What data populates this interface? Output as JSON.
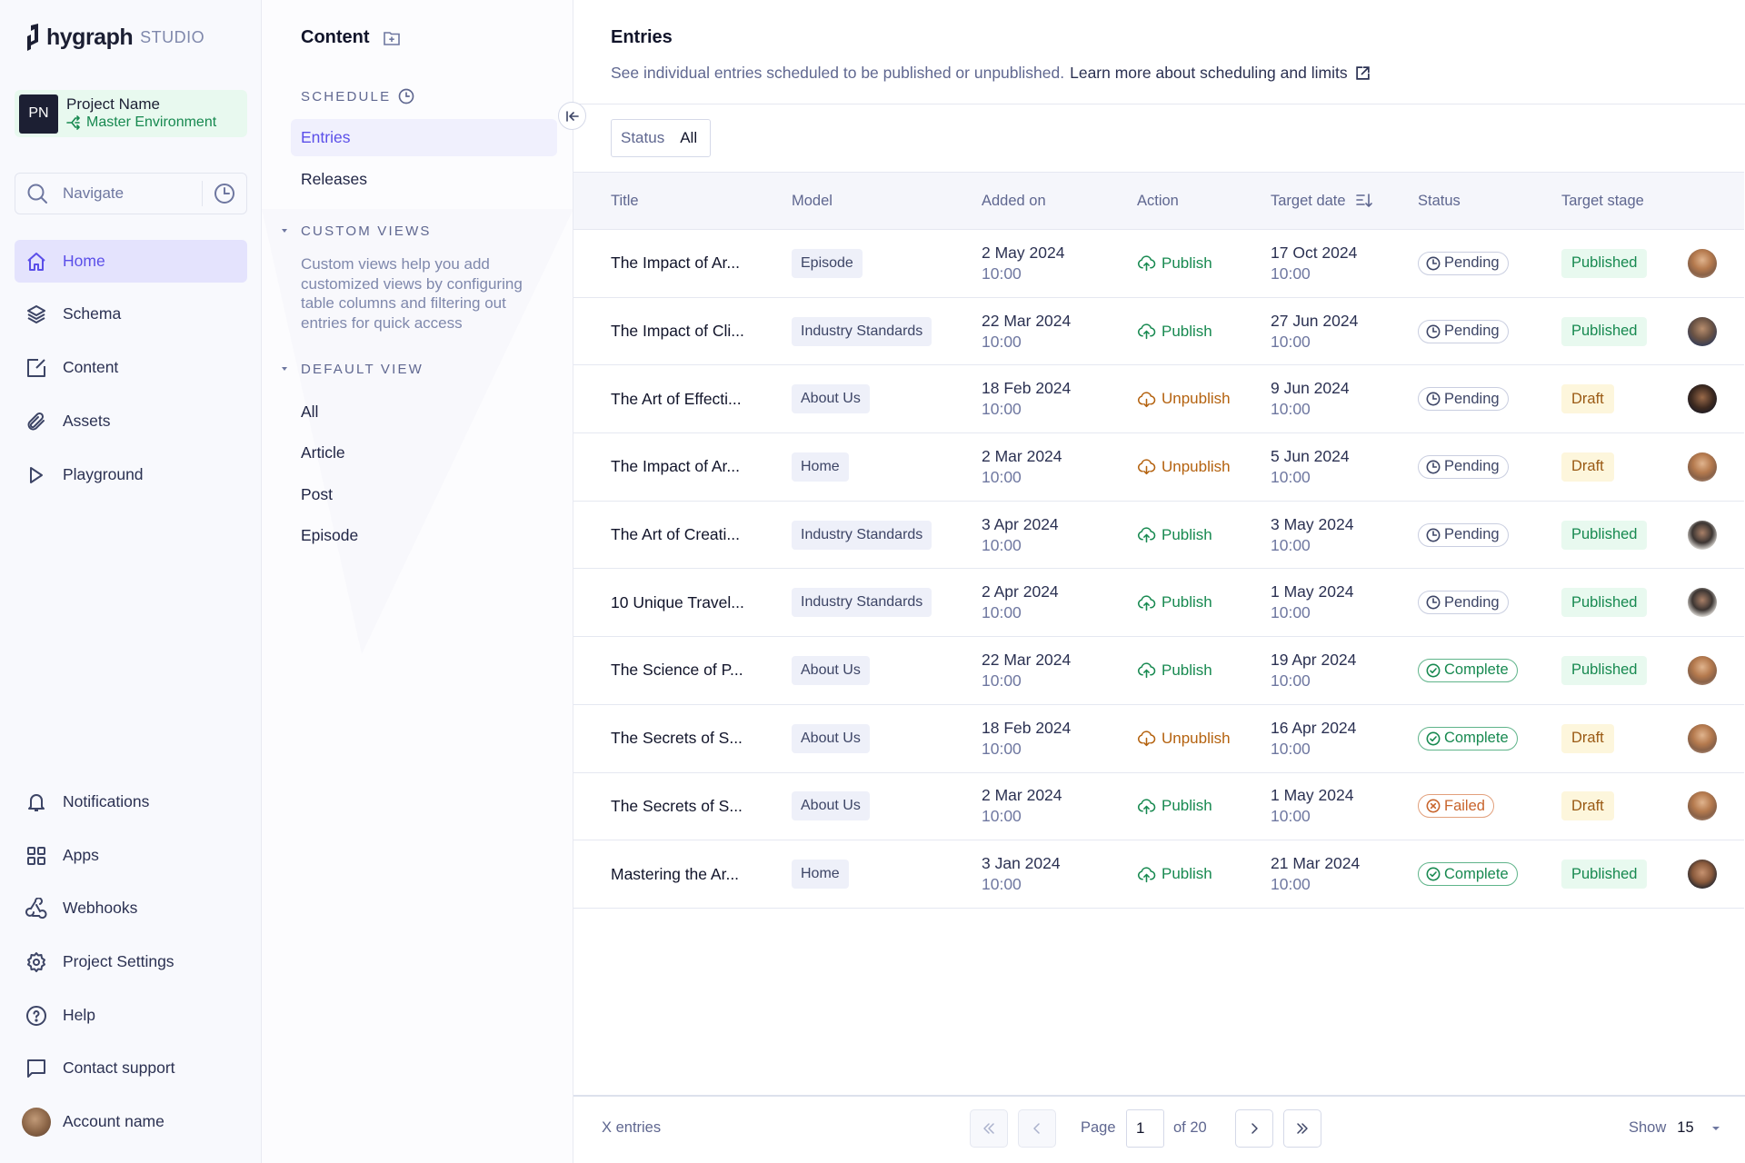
{
  "app": {
    "logo_word": "hygraph",
    "logo_suffix": "STUDIO"
  },
  "project": {
    "initials": "PN",
    "name": "Project Name",
    "environment": "Master Environment"
  },
  "navigate": {
    "placeholder": "Navigate"
  },
  "sidebar": {
    "top_items": [
      {
        "label": "Home",
        "icon": "home-icon",
        "active": true
      },
      {
        "label": "Schema",
        "icon": "layers-icon"
      },
      {
        "label": "Content",
        "icon": "edit-icon"
      },
      {
        "label": "Assets",
        "icon": "paperclip-icon"
      },
      {
        "label": "Playground",
        "icon": "play-icon"
      }
    ],
    "bottom_items": [
      {
        "label": "Notifications",
        "icon": "bell-icon"
      },
      {
        "label": "Apps",
        "icon": "apps-grid-icon"
      },
      {
        "label": "Webhooks",
        "icon": "webhook-icon"
      },
      {
        "label": "Project Settings",
        "icon": "gear-icon"
      },
      {
        "label": "Help",
        "icon": "help-circle-icon"
      },
      {
        "label": "Contact support",
        "icon": "chat-icon"
      },
      {
        "label": "Account name",
        "icon": "account-avatar"
      }
    ]
  },
  "panel": {
    "title": "Content",
    "schedule_label": "SCHEDULE",
    "schedule_items": [
      {
        "label": "Entries",
        "active": true
      },
      {
        "label": "Releases"
      }
    ],
    "custom_views_label": "CUSTOM VIEWS",
    "custom_views_desc": "Custom views help you add customized views by configuring table columns and filtering out entries for quick access",
    "default_view_label": "DEFAULT VIEW",
    "default_view_items": [
      "All",
      "Article",
      "Post",
      "Episode"
    ]
  },
  "main": {
    "title": "Entries",
    "description": "See individual entries scheduled to be published or unpublished.",
    "learn_more": "Learn more about scheduling and limits",
    "filter": {
      "key": "Status",
      "value": "All"
    },
    "columns": [
      "Title",
      "Model",
      "Added on",
      "Action",
      "Target date",
      "Status",
      "Target stage"
    ],
    "rows": [
      {
        "title": "The Impact of Ar...",
        "model": "Episode",
        "added_date": "2 May 2024",
        "added_time": "10:00",
        "action": "Publish",
        "target_date": "17 Oct 2024",
        "target_time": "10:00",
        "status": "Pending",
        "stage": "Published",
        "avatar": "woman-1"
      },
      {
        "title": "The Impact of Cli...",
        "model": "Industry Standards",
        "added_date": "22 Mar 2024",
        "added_time": "10:00",
        "action": "Publish",
        "target_date": "27 Jun 2024",
        "target_time": "10:00",
        "status": "Pending",
        "stage": "Published",
        "avatar": "man-1"
      },
      {
        "title": "The Art of Effecti...",
        "model": "About Us",
        "added_date": "18 Feb 2024",
        "added_time": "10:00",
        "action": "Unpublish",
        "target_date": "9 Jun 2024",
        "target_time": "10:00",
        "status": "Pending",
        "stage": "Draft",
        "avatar": "man-2"
      },
      {
        "title": "The Impact of Ar...",
        "model": "Home",
        "added_date": "2 Mar 2024",
        "added_time": "10:00",
        "action": "Unpublish",
        "target_date": "5 Jun 2024",
        "target_time": "10:00",
        "status": "Pending",
        "stage": "Draft",
        "avatar": "woman-1"
      },
      {
        "title": "The Art of Creati...",
        "model": "Industry Standards",
        "added_date": "3 Apr 2024",
        "added_time": "10:00",
        "action": "Publish",
        "target_date": "3 May 2024",
        "target_time": "10:00",
        "status": "Pending",
        "stage": "Published",
        "avatar": "man-3"
      },
      {
        "title": "10 Unique Travel...",
        "model": "Industry Standards",
        "added_date": "2 Apr 2024",
        "added_time": "10:00",
        "action": "Publish",
        "target_date": "1 May 2024",
        "target_time": "10:00",
        "status": "Pending",
        "stage": "Published",
        "avatar": "man-3"
      },
      {
        "title": "The Science of P...",
        "model": "About Us",
        "added_date": "22 Mar 2024",
        "added_time": "10:00",
        "action": "Publish",
        "target_date": "19 Apr 2024",
        "target_time": "10:00",
        "status": "Complete",
        "stage": "Published",
        "avatar": "woman-1"
      },
      {
        "title": "The Secrets of S...",
        "model": "About Us",
        "added_date": "18 Feb 2024",
        "added_time": "10:00",
        "action": "Unpublish",
        "target_date": "16 Apr 2024",
        "target_time": "10:00",
        "status": "Complete",
        "stage": "Draft",
        "avatar": "woman-1"
      },
      {
        "title": "The Secrets of S...",
        "model": "About Us",
        "added_date": "2 Mar 2024",
        "added_time": "10:00",
        "action": "Publish",
        "target_date": "1 May 2024",
        "target_time": "10:00",
        "status": "Failed",
        "stage": "Draft",
        "avatar": "woman-1"
      },
      {
        "title": "Mastering the Ar...",
        "model": "Home",
        "added_date": "3 Jan 2024",
        "added_time": "10:00",
        "action": "Publish",
        "target_date": "21 Mar 2024",
        "target_time": "10:00",
        "status": "Complete",
        "stage": "Published",
        "avatar": "man-4"
      }
    ]
  },
  "footer": {
    "count": "X entries",
    "page_label": "Page",
    "page_value": "1",
    "page_of": "of 20",
    "show_label": "Show",
    "show_value": "15"
  },
  "colors": {
    "accent": "#5b4fe9",
    "publish": "#178950",
    "unpublish": "#b4620f",
    "complete": "#178950",
    "failed": "#c8642c",
    "published_bg": "#e8f9ef",
    "draft_bg": "#fdf6dc",
    "draft_text": "#9a5a14"
  }
}
